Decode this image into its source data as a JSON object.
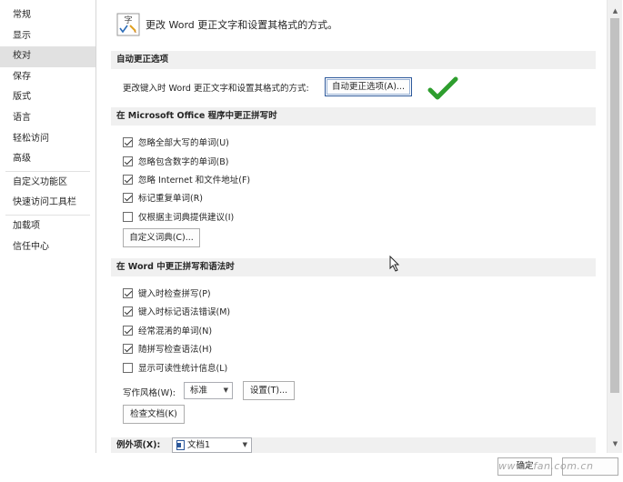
{
  "sidebar": {
    "items": [
      {
        "label": "常规"
      },
      {
        "label": "显示"
      },
      {
        "label": "校对",
        "selected": true
      },
      {
        "label": "保存"
      },
      {
        "label": "版式"
      },
      {
        "label": "语言"
      },
      {
        "label": "轻松访问"
      },
      {
        "label": "高级"
      },
      {
        "label": "自定义功能区"
      },
      {
        "label": "快速访问工具栏"
      },
      {
        "label": "加载项"
      },
      {
        "label": "信任中心"
      }
    ]
  },
  "header": {
    "icon_text": "字",
    "text": "更改 Word 更正文字和设置其格式的方式。"
  },
  "autocorrect": {
    "section_title": "自动更正选项",
    "row_label": "更改键入时 Word 更正文字和设置其格式的方式:",
    "button": "自动更正选项(A)..."
  },
  "office_spelling": {
    "section_title": "在 Microsoft Office 程序中更正拼写时",
    "options": [
      {
        "label": "忽略全部大写的单词(U)",
        "checked": true
      },
      {
        "label": "忽略包含数字的单词(B)",
        "checked": true
      },
      {
        "label": "忽略 Internet 和文件地址(F)",
        "checked": true
      },
      {
        "label": "标记重复单词(R)",
        "checked": true
      },
      {
        "label": "仅根据主词典提供建议(I)",
        "checked": false
      }
    ],
    "dict_button": "自定义词典(C)..."
  },
  "word_spelling": {
    "section_title": "在 Word 中更正拼写和语法时",
    "options": [
      {
        "label": "键入时检查拼写(P)",
        "checked": true
      },
      {
        "label": "键入时标记语法错误(M)",
        "checked": true
      },
      {
        "label": "经常混淆的单词(N)",
        "checked": true
      },
      {
        "label": "随拼写检查语法(H)",
        "checked": true
      },
      {
        "label": "显示可读性统计信息(L)",
        "checked": false
      }
    ],
    "style_label": "写作风格(W):",
    "style_value": "标准",
    "settings_button": "设置(T)...",
    "check_button": "检查文档(K)"
  },
  "exceptions": {
    "label": "例外项(X):",
    "doc_value": "文档1"
  },
  "footer": {
    "ok": "确定",
    "watermark": "www.cfan.com.cn"
  },
  "colors": {
    "selected_nav": "#e1e1e1",
    "section_bg": "#f0f0f0",
    "checkmark_green": "#2e9e2e",
    "focus_border": "#2b579a"
  }
}
